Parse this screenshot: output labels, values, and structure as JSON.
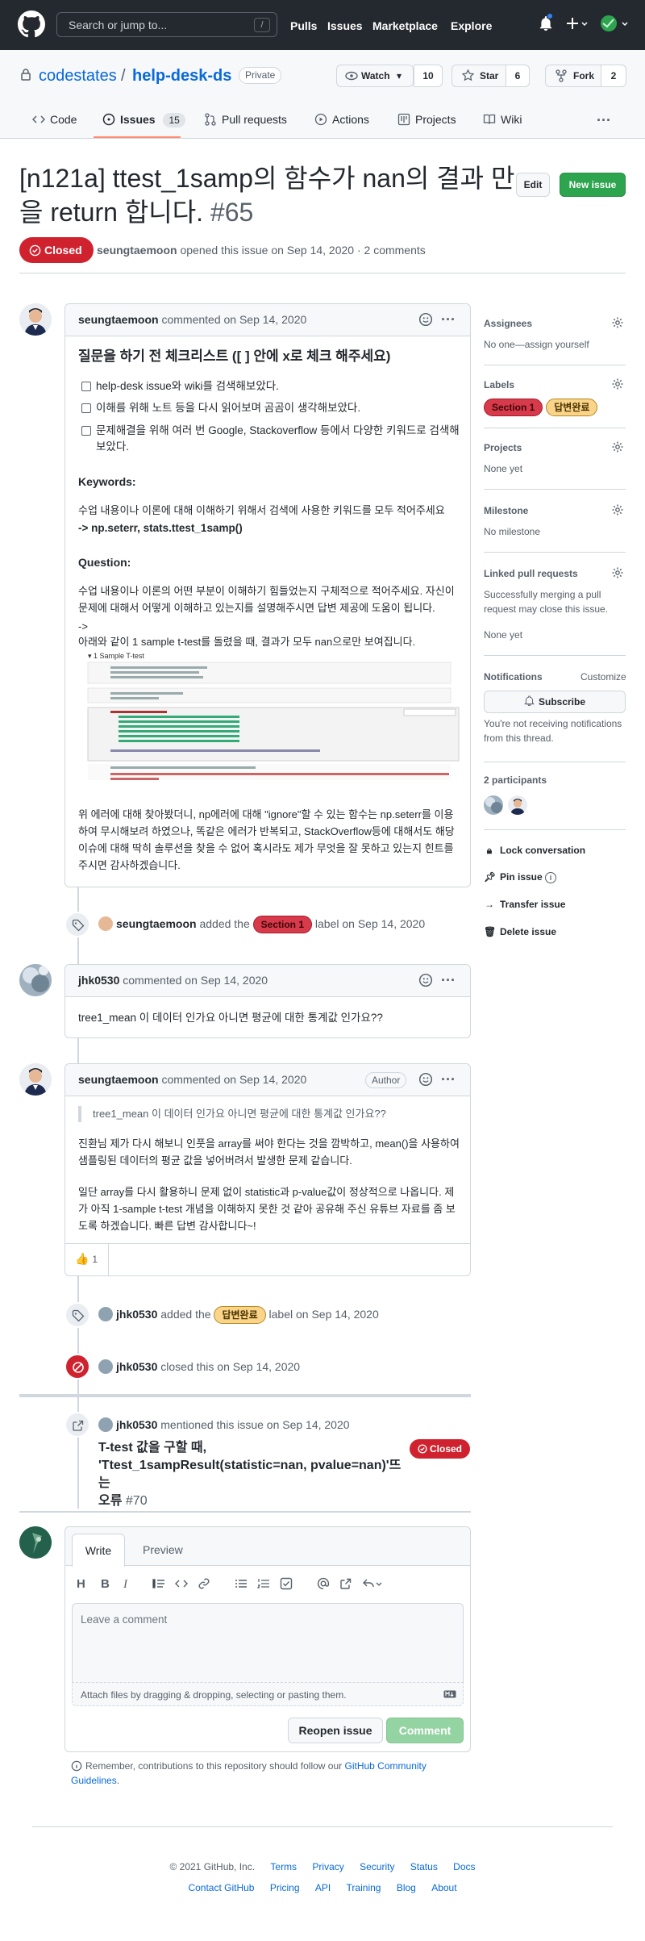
{
  "header": {
    "search_placeholder": "Search or jump to...",
    "slash_key": "/",
    "nav": [
      "Pulls",
      "Issues",
      "Marketplace",
      "Explore"
    ]
  },
  "repo": {
    "owner": "codestates",
    "separator": "/",
    "name": "help-desk-ds",
    "visibility": "Private",
    "watch_label": "Watch",
    "watch_count": "10",
    "star_label": "Star",
    "star_count": "6",
    "fork_label": "Fork",
    "fork_count": "2",
    "tabs": [
      {
        "label": "Code"
      },
      {
        "label": "Issues",
        "count": "15"
      },
      {
        "label": "Pull requests"
      },
      {
        "label": "Actions"
      },
      {
        "label": "Projects"
      },
      {
        "label": "Wiki"
      }
    ],
    "more": "···"
  },
  "issue": {
    "title": "[n121a] ttest_1samp의 함수가 nan의 결과 만을 return 합니다.",
    "number": "#65",
    "edit_label": "Edit",
    "new_issue_label": "New issue",
    "state": "Closed",
    "author": "seungtaemoon",
    "meta_text": "opened this issue on Sep 14, 2020 · 2 comments"
  },
  "first_comment": {
    "author": "seungtaemoon",
    "meta": "commented on Sep 14, 2020",
    "heading": "질문을 하기 전 체크리스트 ([ ] 안에 x로 체크 해주세요)",
    "checklist": [
      "help-desk issue와 wiki를 검색해보았다.",
      "이해를 위해 노트 등을 다시 읽어보며 곰곰이 생각해보았다.",
      "문제해결을 위해 여러 번 Google, Stackoverflow 등에서 다양한 키워드로 검색해 보았다."
    ],
    "keywords_title": "Keywords:",
    "keywords_desc": "수업 내용이나 이론에 대해 이해하기 위해서 검색에 사용한 키워드를 모두 적어주세요",
    "keywords_value": "-> np.seterr, stats.ttest_1samp()",
    "question_title": "Question:",
    "question_desc": "수업 내용이나 이론의 어떤 부분이 이해하기 힘들었는지 구체적으로 적어주세요. 자신이 문제에 대해서 어떻게 이해하고 있는지를 설명해주시면 답변 제공에 도움이 됩니다.",
    "arrow": "->",
    "question_line": "아래와 같이 1 sample t-test를 돌렸을 때, 결과가 모두 nan으로만 보여집니다.",
    "screenshot_title": "1 Sample T-test",
    "closing_text": "위 에러에 대해 찾아봤더니, np에러에 대해 \"ignore\"할 수 있는 함수는 np.seterr를 이용하여 무시해보려 하였으나, 똑같은 에러가 반복되고, StackOverflow등에 대해서도 해당 이슈에 대해 딱히 솔루션을 찾을 수 없어 혹시라도 제가 무엇을 잘 못하고 있는지 힌트를 주시면 감사하겠습니다."
  },
  "events": {
    "label_event_1": {
      "user": "seungtaemoon",
      "pre": "added the",
      "label": "Section 1",
      "post": "label on Sep 14, 2020"
    },
    "label_event_2": {
      "user": "jhk0530",
      "pre": "added the",
      "label": "답변완료",
      "post": "label on Sep 14, 2020"
    },
    "close_event": {
      "user": "jhk0530",
      "text": "closed this on Sep 14, 2020"
    },
    "mention_event": {
      "user": "jhk0530",
      "text": "mentioned this issue on Sep 14, 2020",
      "ref_title_1": "T-test 값을 구할 때,",
      "ref_title_2": "'Ttest_1sampResult(statistic=nan, pvalue=nan)'뜨는",
      "ref_title_3": "오류",
      "ref_number": "#70",
      "ref_state": "Closed"
    }
  },
  "second_comment": {
    "author": "jhk0530",
    "meta": "commented on Sep 14, 2020",
    "body": "tree1_mean 이 데이터 인가요 아니면 평균에 대한 통계값 인가요??"
  },
  "third_comment": {
    "author": "seungtaemoon",
    "meta": "commented on Sep 14, 2020",
    "author_badge": "Author",
    "quote": "tree1_mean 이 데이터 인가요 아니면 평균에 대한 통계값 인가요??",
    "para1": "진환님 제가 다시 해보니 인풋을 array를 써야 한다는 것을 깜박하고, mean()을 사용하여 샘플링된 데이터의 평균 값을 넣어버려서 발생한 문제 같습니다.",
    "para2": "일단 array를 다시 활용하니 문제 없이 statistic과 p-value값이 정상적으로 나옵니다. 제가 아직 1-sample t-test 개념을 이해하지 못한 것 같아 공유해 주신 유튜브 자료를 좀 보도록 하겠습니다. 빠른 답변 감사합니다~!",
    "reaction_emoji": "👍",
    "reaction_count": "1"
  },
  "compose": {
    "tab_write": "Write",
    "tab_preview": "Preview",
    "placeholder": "Leave a comment",
    "attach_text": "Attach files by dragging & dropping, selecting or pasting them.",
    "reopen_label": "Reopen issue",
    "comment_label": "Comment",
    "remember_text": "Remember, contributions to this repository should follow our",
    "remember_link": "GitHub Community Guidelines",
    "remember_end": "."
  },
  "sidebar": {
    "assignees_title": "Assignees",
    "assignees_value": "No one—assign yourself",
    "labels_title": "Labels",
    "label_1": "Section 1",
    "label_2": "답변완료",
    "projects_title": "Projects",
    "projects_value": "None yet",
    "milestone_title": "Milestone",
    "milestone_value": "No milestone",
    "linked_title": "Linked pull requests",
    "linked_desc": "Successfully merging a pull request may close this issue.",
    "linked_value": "None yet",
    "notif_title": "Notifications",
    "notif_customize": "Customize",
    "subscribe_label": "Subscribe",
    "notif_desc": "You're not receiving notifications from this thread.",
    "participants_title": "2 participants",
    "actions": [
      "Lock conversation",
      "Pin issue",
      "Transfer issue",
      "Delete issue"
    ]
  },
  "footer": {
    "copyright": "© 2021 GitHub, Inc.",
    "row1": [
      "Terms",
      "Privacy",
      "Security",
      "Status",
      "Docs"
    ],
    "row2": [
      "Contact GitHub",
      "Pricing",
      "API",
      "Training",
      "Blog",
      "About"
    ]
  },
  "colors": {
    "header_bg": "#24292f",
    "closed_red": "#cf222e",
    "green": "#2da44e",
    "link_blue": "#0969da"
  }
}
